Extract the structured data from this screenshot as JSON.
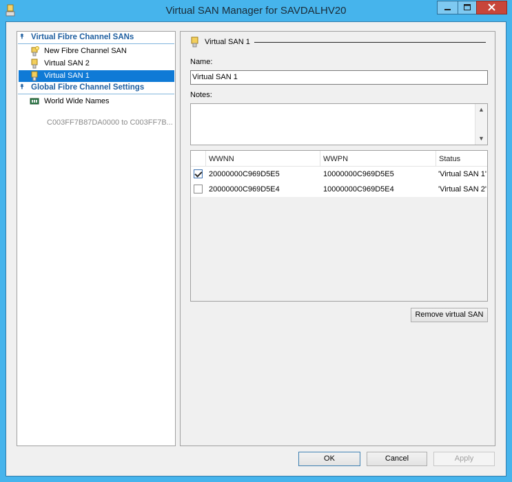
{
  "window": {
    "title": "Virtual SAN Manager for SAVDALHV20"
  },
  "icons": {
    "app": "san-manager-icon",
    "section_collapse": "double-chevron-up-icon",
    "san": "fibre-channel-san-icon",
    "new_san": "new-san-icon",
    "wwn": "world-wide-names-icon"
  },
  "sidebar": {
    "sections": [
      {
        "label": "Virtual Fibre Channel SANs"
      },
      {
        "label": "Global Fibre Channel Settings"
      }
    ],
    "items": [
      {
        "label": "New Fibre Channel SAN"
      },
      {
        "label": "Virtual SAN 2"
      },
      {
        "label": "Virtual SAN 1",
        "selected": true
      },
      {
        "label": "World Wide Names",
        "subtext": "C003FF7B87DA0000 to C003FF7B..."
      }
    ]
  },
  "details": {
    "group_title": "Virtual SAN 1",
    "name_label": "Name:",
    "name_value": "Virtual SAN 1",
    "notes_label": "Notes:",
    "notes_value": "",
    "table": {
      "columns": [
        "WWNN",
        "WWPN",
        "Status"
      ],
      "rows": [
        {
          "checked": true,
          "wwnn": "20000000C969D5E5",
          "wwpn": "10000000C969D5E5",
          "status": "'Virtual SAN 1'"
        },
        {
          "checked": false,
          "wwnn": "20000000C969D5E4",
          "wwpn": "10000000C969D5E4",
          "status": "'Virtual SAN 2'"
        }
      ]
    },
    "remove_button": "Remove virtual SAN"
  },
  "footer": {
    "ok": "OK",
    "cancel": "Cancel",
    "apply": "Apply"
  },
  "colors": {
    "accent": "#0f7ad6",
    "section_text": "#1f5fa0",
    "titlebar": "#46b4ec"
  }
}
